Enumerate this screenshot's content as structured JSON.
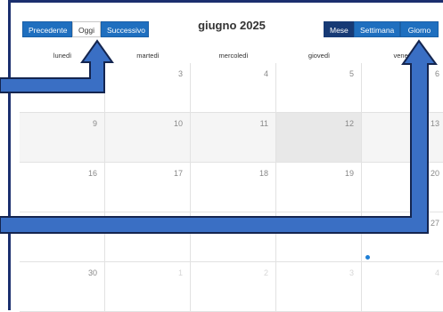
{
  "toolbar": {
    "prev_label": "Precedente",
    "today_label": "Oggi",
    "next_label": "Successivo",
    "title": "giugno 2025",
    "view_month": "Mese",
    "view_week": "Settimana",
    "view_day": "Giorno"
  },
  "weekdays": [
    "lunedì",
    "martedì",
    "mercoledì",
    "giovedì",
    "venerdì"
  ],
  "weeks": [
    [
      "",
      "3",
      "4",
      "5",
      "6"
    ],
    [
      "9",
      "10",
      "11",
      "12",
      "13"
    ],
    [
      "16",
      "17",
      "18",
      "19",
      "20"
    ],
    [
      "",
      "",
      "",
      "",
      "27"
    ],
    [
      "30",
      "1",
      "2",
      "3",
      "4"
    ]
  ],
  "colors": {
    "primary": "#1f6fbf",
    "active_view": "#173a75",
    "annotation": "#3a6fc4"
  }
}
